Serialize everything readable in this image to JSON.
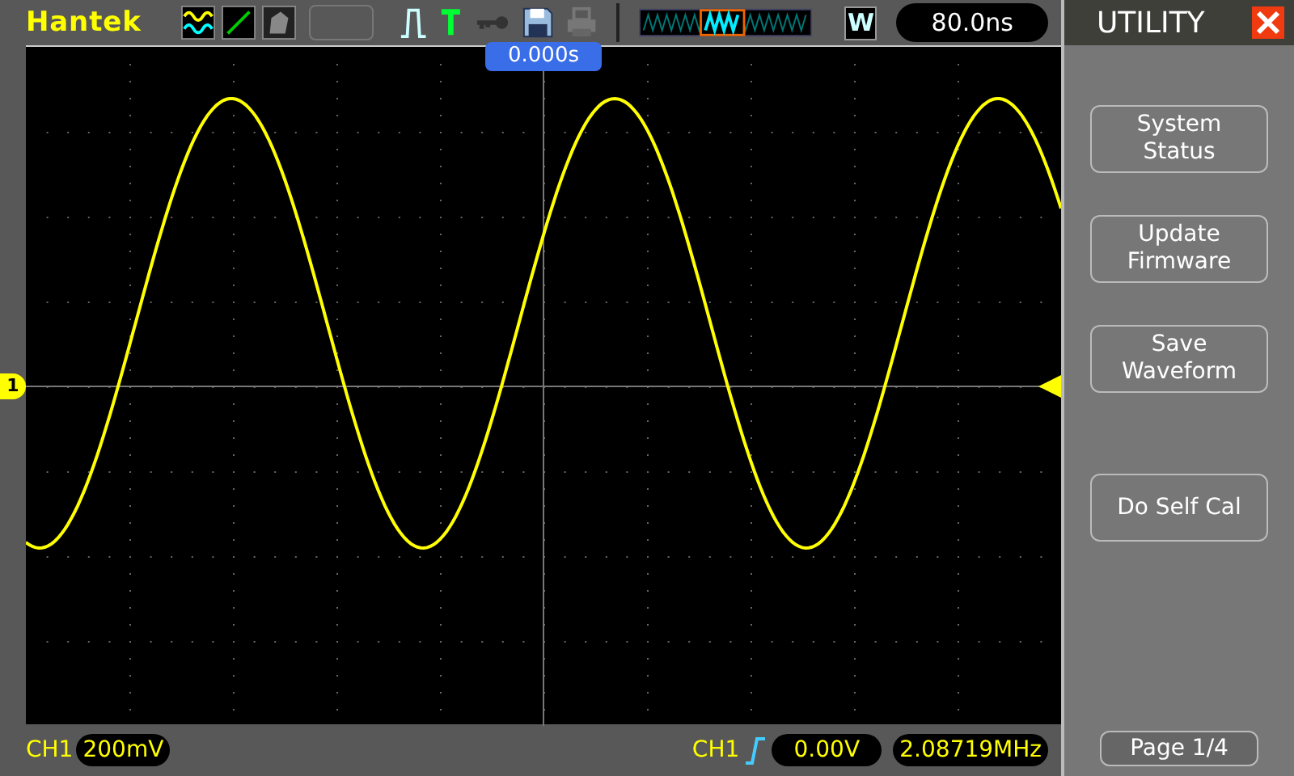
{
  "brand": "Hantek",
  "w_key": "W",
  "timebase": "80.0ns",
  "trigger_position": "0.000s",
  "channel_marker": "1",
  "menu": {
    "title": "UTILITY",
    "buttons": [
      [
        "System",
        "Status"
      ],
      [
        "Update",
        "Firmware"
      ],
      [
        "Save",
        "Waveform"
      ],
      [
        "Do Self Cal"
      ]
    ],
    "page": "Page 1/4"
  },
  "status_bar": {
    "channel": "CH1",
    "volts_per_div": "200mV",
    "trigger_source": "CH1",
    "trigger_level": "0.00V",
    "frequency": "2.08719MHz"
  }
}
